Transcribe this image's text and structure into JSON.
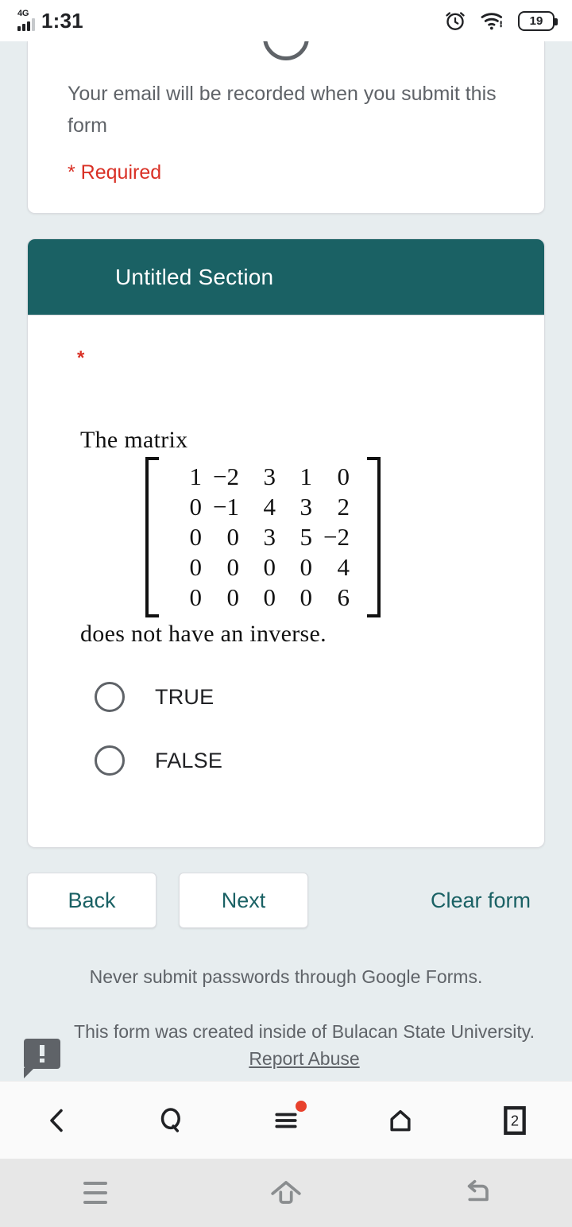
{
  "status_bar": {
    "network": "4G",
    "time": "1:31",
    "alarm_icon": "alarm-clock-icon",
    "wifi_icon": "wifi-icon",
    "battery_level": "19"
  },
  "form": {
    "email_notice": "Your email will be recorded when you submit this form",
    "required_notice": "* Required",
    "section": {
      "title": "Untitled Section",
      "header_color": "#1a6164"
    },
    "question": {
      "required_marker": "*",
      "text_before_matrix": "The matrix",
      "text_after_matrix": "does not have an inverse.",
      "matrix": [
        [
          "1",
          "−2",
          "3",
          "1",
          "0"
        ],
        [
          "0",
          "−1",
          "4",
          "3",
          "2"
        ],
        [
          "0",
          "0",
          "3",
          "5",
          "−2"
        ],
        [
          "0",
          "0",
          "0",
          "0",
          "4"
        ],
        [
          "0",
          "0",
          "0",
          "0",
          "6"
        ]
      ],
      "options": [
        {
          "label": "TRUE",
          "selected": false
        },
        {
          "label": "FALSE",
          "selected": false
        }
      ]
    },
    "nav": {
      "back_label": "Back",
      "next_label": "Next",
      "clear_label": "Clear form"
    },
    "footer": {
      "never_submit": "Never submit passwords through Google Forms.",
      "created_inside": "This form was created inside of Bulacan State University.",
      "report_abuse": "Report Abuse",
      "abuse_icon": "report-abuse-icon"
    },
    "accent_color": "#1a6164",
    "required_color": "#d93025"
  },
  "browser_toolbar": {
    "items": [
      {
        "name": "back-icon",
        "label": ""
      },
      {
        "name": "search-icon",
        "label": ""
      },
      {
        "name": "menu-icon",
        "label": "",
        "badge": true
      },
      {
        "name": "home-icon",
        "label": ""
      },
      {
        "name": "tabs-icon",
        "label": "2"
      }
    ]
  },
  "android_nav": {
    "items": [
      {
        "name": "recents-icon"
      },
      {
        "name": "home-icon"
      },
      {
        "name": "back-icon"
      }
    ]
  }
}
